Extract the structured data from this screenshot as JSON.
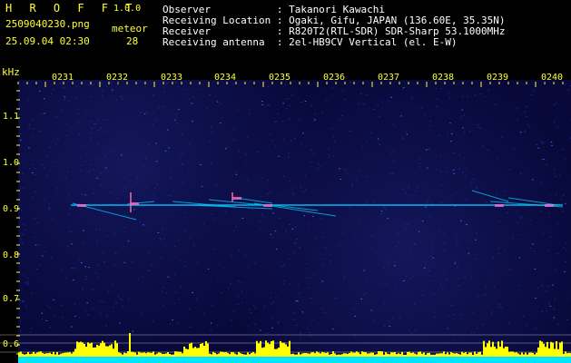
{
  "header": {
    "app_title": "H R O F F T",
    "app_version": "1.0.0",
    "file_name": "2509040230.png",
    "meteor_label": "meteor",
    "datetime": "25.09.04 02:30",
    "meteor_count": "28",
    "info_lines": [
      "Observer           : Takanori Kawachi",
      "Receiving Location : Ogaki, Gifu, JAPAN (136.60E, 35.35N)",
      "Receiver           : R820T2(RTL-SDR) SDR-Sharp 53.1000MHz",
      "Receiving antenna  : 2el-HB9CV Vertical (el. E-W)"
    ]
  },
  "axis": {
    "y_unit": "kHz",
    "y_ticks": [
      "1.1",
      "1.0",
      "0.9",
      "0.8",
      "0.7",
      "0.6"
    ],
    "x_ticks": [
      "0231",
      "0232",
      "0233",
      "0234",
      "0235",
      "0236",
      "0237",
      "0238",
      "0239",
      "0240"
    ]
  },
  "colors": {
    "label": "#ffff33",
    "info": "#ffffff",
    "background": "#08083a",
    "echo": "#00ccff",
    "echo_core": "#ff66cc",
    "signal_bar": "#ffff00",
    "baseline": "#00e5ff"
  }
}
